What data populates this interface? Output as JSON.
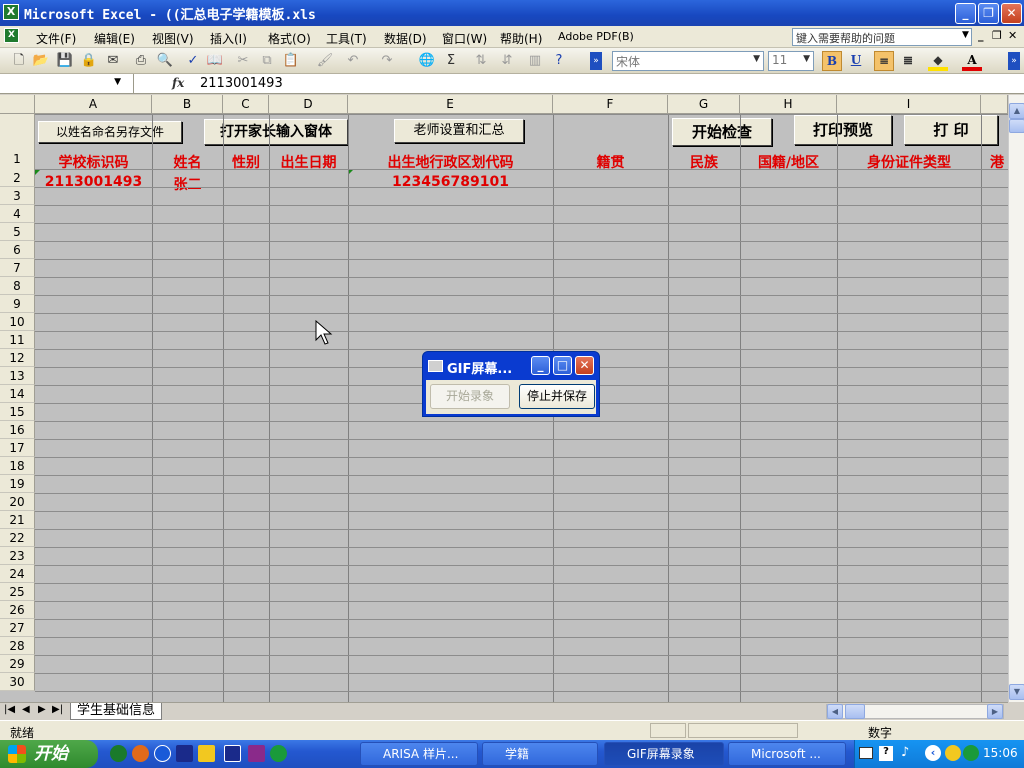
{
  "window": {
    "title": "Microsoft Excel - ((汇总电子学籍模板.xls"
  },
  "menu": [
    "文件(F)",
    "编辑(E)",
    "视图(V)",
    "插入(I)",
    "格式(O)",
    "工具(T)",
    "数据(D)",
    "窗口(W)",
    "帮助(H)",
    "Adobe PDF(B)"
  ],
  "help_search": {
    "placeholder": "键入需要帮助的问题"
  },
  "toolbar": {
    "font_name": "宋体",
    "font_size": "11",
    "bold": "B",
    "underline": "U",
    "font_color_label": "A"
  },
  "formula_bar": {
    "fx": "fx",
    "value": "2113001493"
  },
  "columns": [
    "A",
    "B",
    "C",
    "D",
    "E",
    "F",
    "G",
    "H",
    "I"
  ],
  "buttons": {
    "save_by_name": "以姓名命名另存文件",
    "open_parent_form": "打开家长输入窗体",
    "teacher_settings": "老师设置和汇总",
    "start_check": "开始检查",
    "print_preview": "打印预览",
    "print": "打 印"
  },
  "headers": [
    "学校标识码",
    "姓名",
    "性别",
    "出生日期",
    "出生地行政区划代码",
    "籍贯",
    "民族",
    "国籍/地区",
    "身份证件类型",
    "港"
  ],
  "row2": [
    "2113001493",
    "张二",
    "",
    "",
    "123456789101",
    "",
    "",
    "",
    ""
  ],
  "row_numbers": [
    "1",
    "2",
    "3",
    "4",
    "5",
    "6",
    "7",
    "8",
    "9",
    "10",
    "11",
    "12",
    "13",
    "14",
    "15",
    "16",
    "17",
    "18",
    "19",
    "20",
    "21",
    "22",
    "23",
    "24",
    "25",
    "26",
    "27",
    "28",
    "29",
    "30"
  ],
  "sheet_tab": "学生基础信息",
  "status": {
    "ready": "就绪",
    "mode": "数字"
  },
  "gif_dialog": {
    "title": "GIF屏幕...",
    "start": "开始录象",
    "stop": "停止并保存"
  },
  "taskbar": {
    "start": "开始",
    "tasks": [
      "ARISA 样片...",
      "学籍",
      "GIF屏幕录象",
      "Microsoft ..."
    ],
    "clock": "15:06"
  }
}
